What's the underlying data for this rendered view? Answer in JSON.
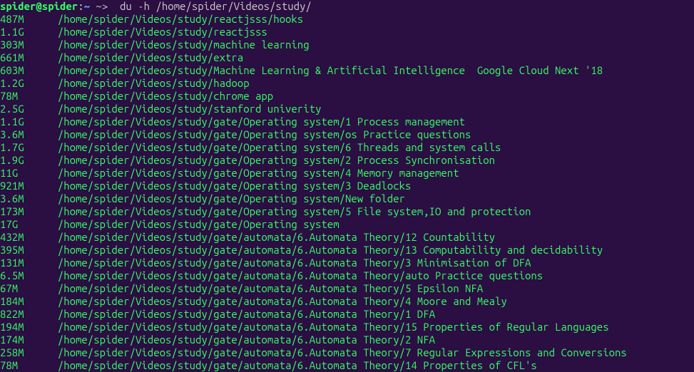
{
  "prompt": {
    "user_host": "spider@spider",
    "separator": ":",
    "tilde": "~",
    "symbols": " ~>  ",
    "command": "du -h /home/spider/Videos/study/"
  },
  "lines": [
    {
      "size": "487M",
      "path": "/home/spider/Videos/study/reactjsss/hooks"
    },
    {
      "size": "1.1G",
      "path": "/home/spider/Videos/study/reactjsss"
    },
    {
      "size": "303M",
      "path": "/home/spider/Videos/study/machine learning"
    },
    {
      "size": "661M",
      "path": "/home/spider/Videos/study/extra"
    },
    {
      "size": "603M",
      "path": "/home/spider/Videos/study/Machine Learning & Artificial Intelligence  Google Cloud Next '18"
    },
    {
      "size": "1.2G",
      "path": "/home/spider/Videos/study/hadoop"
    },
    {
      "size": "78M",
      "path": "/home/spider/Videos/study/chrome app"
    },
    {
      "size": "2.5G",
      "path": "/home/spider/Videos/study/stanford univerity"
    },
    {
      "size": "1.1G",
      "path": "/home/spider/Videos/study/gate/Operating system/1 Process management"
    },
    {
      "size": "3.6M",
      "path": "/home/spider/Videos/study/gate/Operating system/os Practice questions"
    },
    {
      "size": "1.7G",
      "path": "/home/spider/Videos/study/gate/Operating system/6 Threads and system calls"
    },
    {
      "size": "1.9G",
      "path": "/home/spider/Videos/study/gate/Operating system/2 Process Synchronisation"
    },
    {
      "size": "11G",
      "path": "/home/spider/Videos/study/gate/Operating system/4 Memory management"
    },
    {
      "size": "921M",
      "path": "/home/spider/Videos/study/gate/Operating system/3 Deadlocks"
    },
    {
      "size": "3.6M",
      "path": "/home/spider/Videos/study/gate/Operating system/New folder"
    },
    {
      "size": "173M",
      "path": "/home/spider/Videos/study/gate/Operating system/5 File system,IO and protection"
    },
    {
      "size": "17G",
      "path": "/home/spider/Videos/study/gate/Operating system"
    },
    {
      "size": "432M",
      "path": "/home/spider/Videos/study/gate/automata/6.Automata Theory/12 Countability"
    },
    {
      "size": "395M",
      "path": "/home/spider/Videos/study/gate/automata/6.Automata Theory/13 Computability and decidability"
    },
    {
      "size": "131M",
      "path": "/home/spider/Videos/study/gate/automata/6.Automata Theory/3 Minimisation of DFA"
    },
    {
      "size": "6.5M",
      "path": "/home/spider/Videos/study/gate/automata/6.Automata Theory/auto Practice questions"
    },
    {
      "size": "67M",
      "path": "/home/spider/Videos/study/gate/automata/6.Automata Theory/5 Epsilon NFA"
    },
    {
      "size": "184M",
      "path": "/home/spider/Videos/study/gate/automata/6.Automata Theory/4 Moore and Mealy"
    },
    {
      "size": "822M",
      "path": "/home/spider/Videos/study/gate/automata/6.Automata Theory/1 DFA"
    },
    {
      "size": "194M",
      "path": "/home/spider/Videos/study/gate/automata/6.Automata Theory/15 Properties of Regular Languages"
    },
    {
      "size": "174M",
      "path": "/home/spider/Videos/study/gate/automata/6.Automata Theory/2 NFA"
    },
    {
      "size": "258M",
      "path": "/home/spider/Videos/study/gate/automata/6.Automata Theory/7 Regular Expressions and Conversions"
    },
    {
      "size": "78M",
      "path": "/home/spider/Videos/study/gate/automata/6.Automata Theory/14 Properties of CFL's"
    }
  ]
}
